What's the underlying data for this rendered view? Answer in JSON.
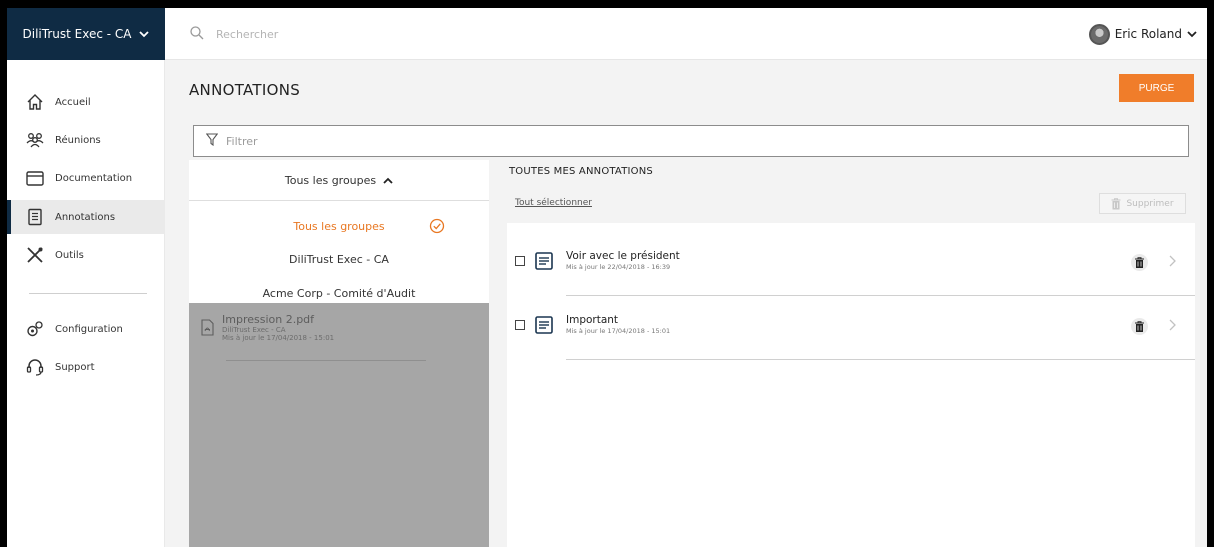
{
  "topbar": {
    "brand": "DiliTrust Exec - CA",
    "search_placeholder": "Rechercher",
    "user_name": "Eric Roland"
  },
  "sidebar": {
    "items": [
      {
        "label": "Accueil",
        "icon": "home-icon"
      },
      {
        "label": "Réunions",
        "icon": "people-icon"
      },
      {
        "label": "Documentation",
        "icon": "folder-icon"
      },
      {
        "label": "Annotations",
        "icon": "notes-icon",
        "active": true
      },
      {
        "label": "Outils",
        "icon": "tools-icon"
      },
      {
        "label": "Configuration",
        "icon": "gears-icon"
      },
      {
        "label": "Support",
        "icon": "headset-icon"
      }
    ]
  },
  "main": {
    "title": "ANNOTATIONS",
    "purge_label": "PURGE",
    "filter_placeholder": "Filtrer"
  },
  "groups": {
    "header": "Tous les groupes",
    "options": [
      "Tous les groupes",
      "DiliTrust Exec - CA",
      "Acme Corp - Comité d'Audit"
    ],
    "selected_index": 0,
    "document": {
      "name": "Impression 2.pdf",
      "group": "DiliTrust Exec - CA",
      "updated": "Mis à jour le 17/04/2018 - 15:01"
    }
  },
  "annotations": {
    "section_title": "TOUTES MES ANNOTATIONS",
    "select_all": "Tout sélectionner",
    "delete_label": "Supprimer",
    "items": [
      {
        "title": "Voir avec le président",
        "updated": "Mis à jour le 22/04/2018 - 16:39"
      },
      {
        "title": "Important",
        "updated": "Mis à jour le 17/04/2018 - 15:01"
      }
    ]
  },
  "colors": {
    "brand_bg": "#0f2b44",
    "accent": "#f07d2a",
    "selected_text": "#e87722"
  }
}
